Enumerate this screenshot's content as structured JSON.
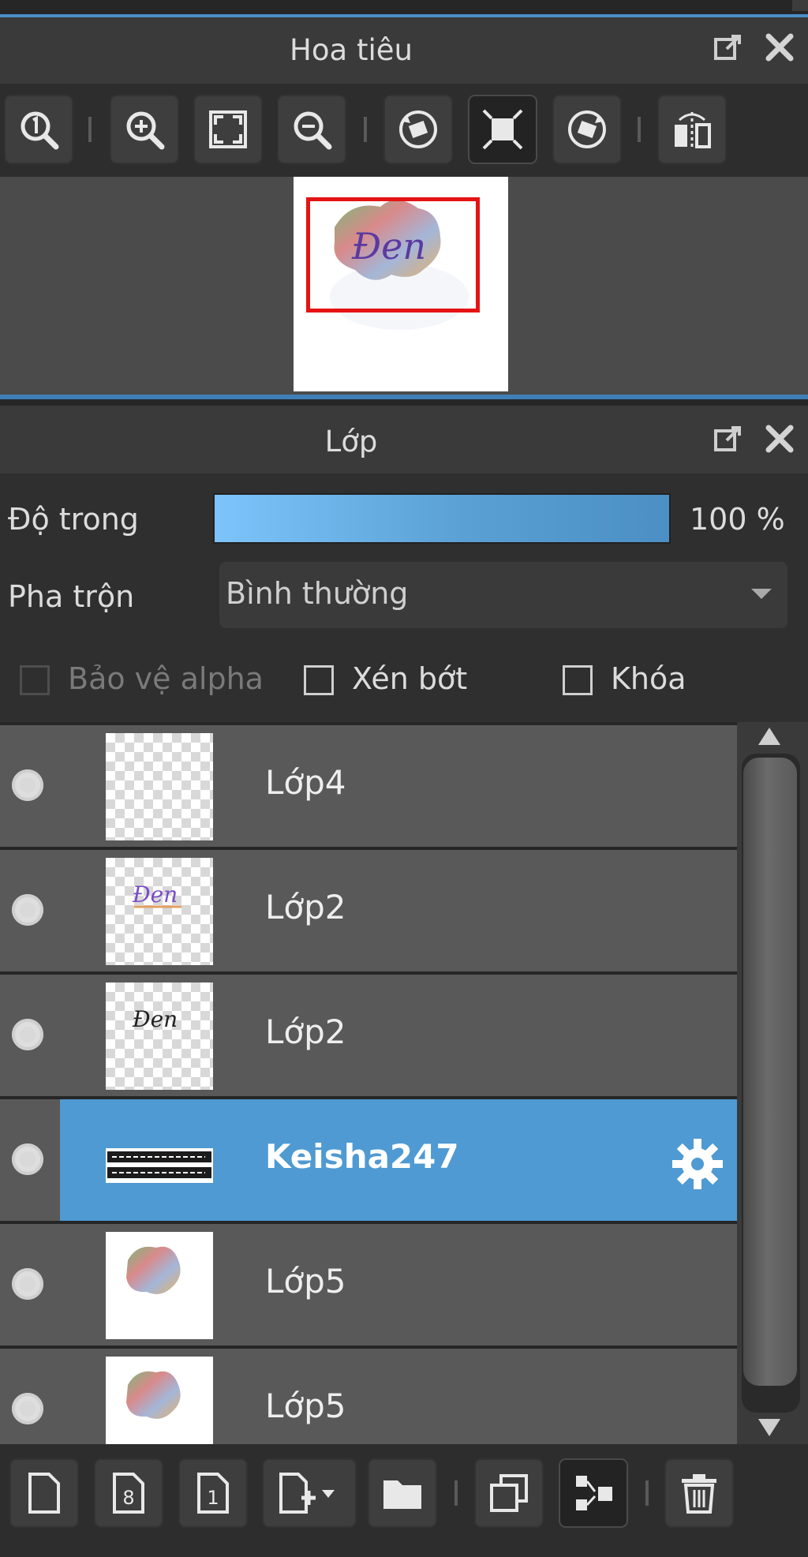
{
  "navigator": {
    "title": "Hoa tiêu",
    "toolbar": [
      {
        "name": "actual-size",
        "icon": "zoom-actual-size-icon"
      },
      {
        "name": "zoom-in",
        "icon": "zoom-in-icon"
      },
      {
        "name": "fit-to-window",
        "icon": "fit-window-icon"
      },
      {
        "name": "zoom-out",
        "icon": "zoom-out-icon"
      },
      {
        "name": "rotate-left",
        "icon": "rotate-left-icon"
      },
      {
        "name": "reset-view",
        "icon": "reset-view-icon"
      },
      {
        "name": "rotate-right",
        "icon": "rotate-right-icon"
      },
      {
        "name": "flip-horizontal",
        "icon": "flip-horizontal-icon"
      }
    ],
    "preview_text": "Đen"
  },
  "layers_panel": {
    "title": "Lớp",
    "opacity_label": "Độ trong",
    "opacity_value": "100 %",
    "opacity_fraction": 1.0,
    "blend_label": "Pha trộn",
    "blend_value": "Bình thường",
    "checkboxes": {
      "protect_alpha": "Bảo vệ alpha",
      "clipping": "Xén bớt",
      "lock": "Khóa"
    },
    "layers": [
      {
        "name": "Lớp4",
        "thumb": "empty",
        "selected": false
      },
      {
        "name": "Lớp2",
        "thumb": "text-color",
        "selected": false
      },
      {
        "name": "Lớp2",
        "thumb": "text-black",
        "selected": false
      },
      {
        "name": "Keisha247",
        "thumb": "text-strip",
        "selected": true
      },
      {
        "name": "Lớp5",
        "thumb": "blob",
        "selected": false
      },
      {
        "name": "Lớp5",
        "thumb": "blob",
        "selected": false
      }
    ],
    "bottom_toolbar": [
      {
        "name": "new-layer",
        "icon": "new-page-icon"
      },
      {
        "name": "new-8bit-layer",
        "icon": "new-8bit-layer-icon"
      },
      {
        "name": "new-1bit-layer",
        "icon": "new-1bit-layer-icon"
      },
      {
        "name": "add-layer-menu",
        "icon": "add-layer-dropdown-icon"
      },
      {
        "name": "new-folder",
        "icon": "folder-icon"
      },
      {
        "name": "duplicate-layer",
        "icon": "duplicate-icon"
      },
      {
        "name": "merge-down",
        "icon": "merge-down-icon"
      },
      {
        "name": "delete-layer",
        "icon": "trash-icon"
      }
    ]
  },
  "colors": {
    "accent": "#4f9ad2",
    "panel_header": "#3a3a3a",
    "viewport_frame": "#e51313"
  }
}
